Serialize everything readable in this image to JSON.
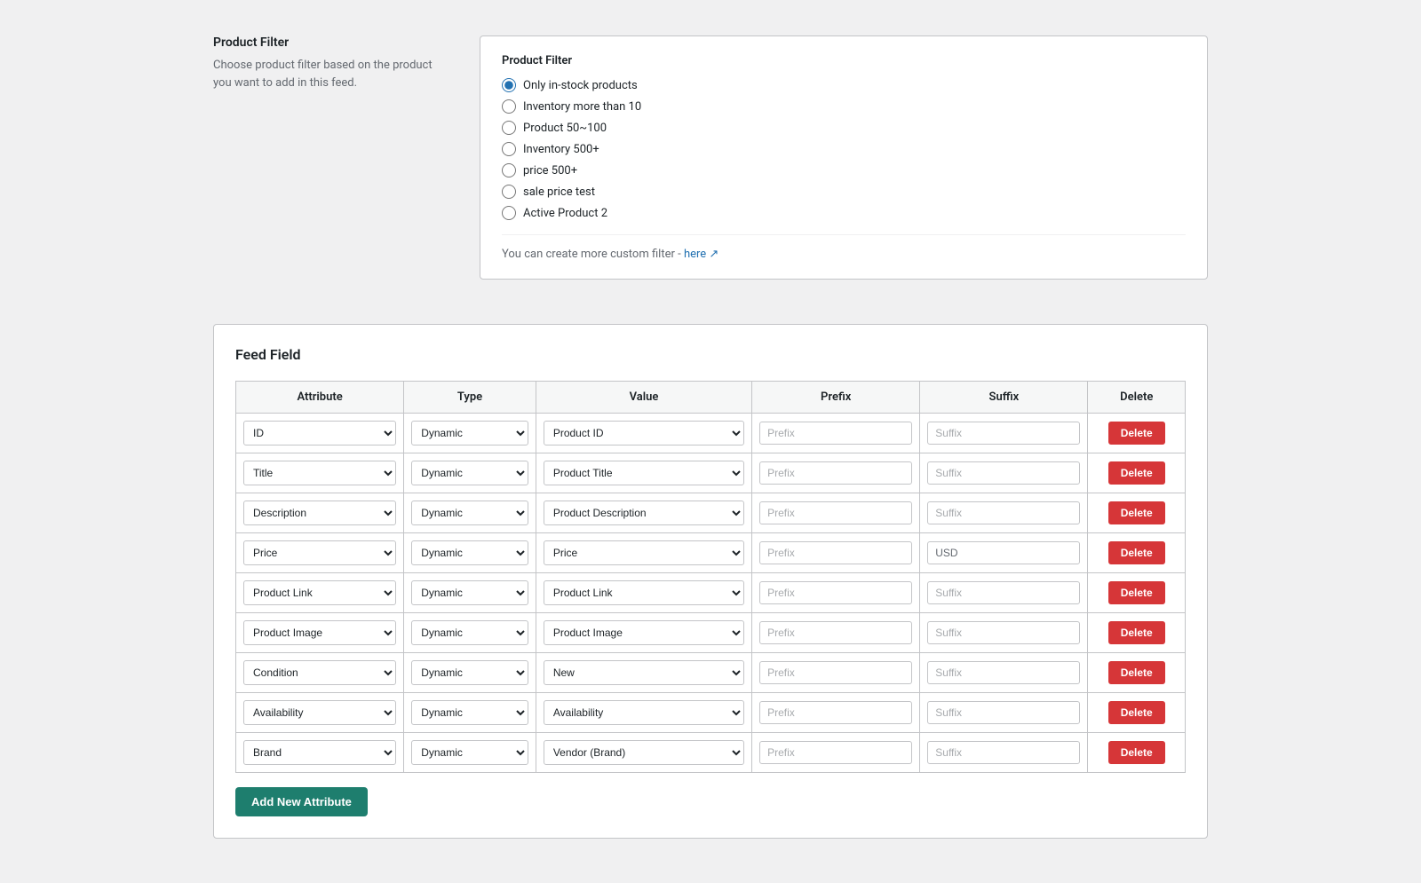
{
  "productFilter": {
    "leftTitle": "Product Filter",
    "leftDescription": "Choose product filter based on the product you want to add in this feed.",
    "rightTitle": "Product Filter",
    "options": [
      {
        "id": "opt1",
        "label": "Only in-stock products",
        "checked": true
      },
      {
        "id": "opt2",
        "label": "Inventory more than 10",
        "checked": false
      },
      {
        "id": "opt3",
        "label": "Product 50~100",
        "checked": false
      },
      {
        "id": "opt4",
        "label": "Inventory 500+",
        "checked": false
      },
      {
        "id": "opt5",
        "label": "price 500+",
        "checked": false
      },
      {
        "id": "opt6",
        "label": "sale price test",
        "checked": false
      },
      {
        "id": "opt7",
        "label": "Active Product 2",
        "checked": false
      }
    ],
    "customFilterNote": "You can create more custom filter -",
    "customFilterLinkLabel": "here",
    "customFilterLinkHref": "#"
  },
  "feedField": {
    "title": "Feed Field",
    "tableHeaders": {
      "attribute": "Attribute",
      "type": "Type",
      "value": "Value",
      "prefix": "Prefix",
      "suffix": "Suffix",
      "delete": "Delete"
    },
    "rows": [
      {
        "attribute": "ID",
        "type": "Dynamic",
        "value": "Product ID",
        "prefix": "",
        "suffix": "",
        "prefixPlaceholder": "Prefix",
        "suffixPlaceholder": "Suffix"
      },
      {
        "attribute": "Title",
        "type": "Dynamic",
        "value": "Product Title",
        "prefix": "",
        "suffix": "",
        "prefixPlaceholder": "Prefix",
        "suffixPlaceholder": "Suffix"
      },
      {
        "attribute": "Description",
        "type": "Dynamic",
        "value": "Product Description",
        "prefix": "",
        "suffix": "",
        "prefixPlaceholder": "Prefix",
        "suffixPlaceholder": "Suffix"
      },
      {
        "attribute": "Price",
        "type": "Dynamic",
        "value": "Price",
        "prefix": "",
        "suffix": "USD",
        "prefixPlaceholder": "Prefix",
        "suffixPlaceholder": "Suffix"
      },
      {
        "attribute": "Product Link",
        "type": "Dynamic",
        "value": "Product Link",
        "prefix": "",
        "suffix": "",
        "prefixPlaceholder": "Prefix",
        "suffixPlaceholder": "Suffix"
      },
      {
        "attribute": "Product Image",
        "type": "Dynamic",
        "value": "Product Image",
        "prefix": "",
        "suffix": "",
        "prefixPlaceholder": "Prefix",
        "suffixPlaceholder": "Suffix"
      },
      {
        "attribute": "Condition",
        "type": "Dynamic",
        "value": "New",
        "prefix": "",
        "suffix": "",
        "prefixPlaceholder": "Prefix",
        "suffixPlaceholder": "Suffix"
      },
      {
        "attribute": "Availability",
        "type": "Dynamic",
        "value": "Availability",
        "prefix": "",
        "suffix": "",
        "prefixPlaceholder": "Prefix",
        "suffixPlaceholder": "Suffix"
      },
      {
        "attribute": "Brand",
        "type": "Dynamic",
        "value": "Vendor (Brand)",
        "prefix": "",
        "suffix": "",
        "prefixPlaceholder": "Prefix",
        "suffixPlaceholder": "Suffix"
      }
    ],
    "deleteLabel": "Delete",
    "addButtonLabel": "Add New Attribute"
  }
}
